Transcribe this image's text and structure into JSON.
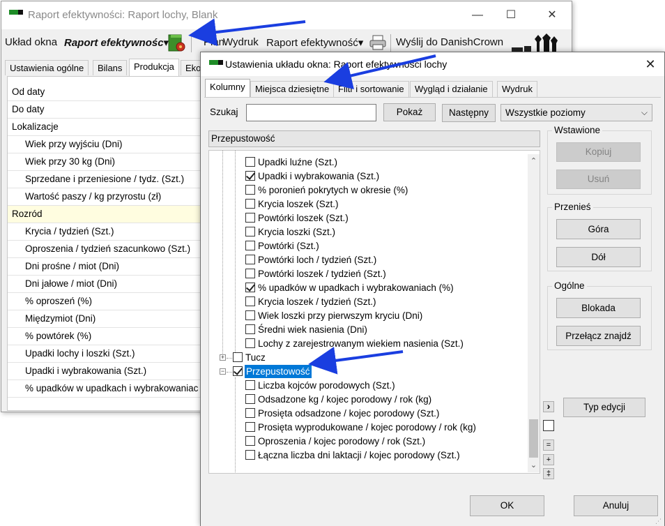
{
  "main_window": {
    "title": "Raport efektywności: Raport lochy, Blank",
    "controls": {
      "minimize": "—",
      "maximize": "☐",
      "close": "✕"
    },
    "toolbar": {
      "layout_label": "Układ okna",
      "layout_value": "Raport efektywnośc▾",
      "plan": "Plan",
      "print": "Wydruk",
      "report": "Raport efektywność▾",
      "send": "Wyślij do DanishCrown"
    },
    "tabs": [
      "Ustawienia ogólne",
      "Bilans",
      "Produkcja",
      "Eko"
    ],
    "rows": [
      {
        "label": "Od daty",
        "kind": "group"
      },
      {
        "label": "Do daty",
        "kind": "group"
      },
      {
        "label": "Lokalizacje",
        "kind": "group"
      },
      {
        "label": "Wiek przy wyjściu (Dni)",
        "kind": "item"
      },
      {
        "label": "Wiek przy 30 kg (Dni)",
        "kind": "item"
      },
      {
        "label": "Sprzedane i przeniesione / tydz. (Szt.)",
        "kind": "item"
      },
      {
        "label": "Wartość paszy / kg przyrostu (zł)",
        "kind": "item"
      },
      {
        "label": "Rozród",
        "kind": "group-hl"
      },
      {
        "label": "Krycia / tydzień (Szt.)",
        "kind": "item"
      },
      {
        "label": "Oproszenia / tydzień szacunkowo (Szt.)",
        "kind": "item"
      },
      {
        "label": "Dni prośne / miot (Dni)",
        "kind": "item"
      },
      {
        "label": "Dni jałowe / miot (Dni)",
        "kind": "item"
      },
      {
        "label": "% oproszeń (%)",
        "kind": "item"
      },
      {
        "label": "Międzymiot (Dni)",
        "kind": "item"
      },
      {
        "label": "% powtórek (%)",
        "kind": "item"
      },
      {
        "label": "Upadki lochy i loszki (Szt.)",
        "kind": "item"
      },
      {
        "label": "Upadki i wybrakowania (Szt.)",
        "kind": "item"
      },
      {
        "label": "% upadków w upadkach i wybrakowaniac",
        "kind": "item"
      }
    ]
  },
  "dialog": {
    "title": "Ustawienia układu okna: Raport efektywności lochy",
    "close": "✕",
    "tabs": [
      "Kolumny",
      "Miejsca dziesiętne",
      "Filtr i sortowanie",
      "Wygląd i działanie",
      "Wydruk"
    ],
    "search_label": "Szukaj",
    "search_value": "",
    "show_button": "Pokaż",
    "next_button": "Następny",
    "level_select": "Wszystkie poziomy",
    "header": "Przepustowość",
    "tree": [
      {
        "label": "Upadki luźne (Szt.)",
        "checked": false,
        "level": 1
      },
      {
        "label": "Upadki i wybrakowania (Szt.)",
        "checked": true,
        "level": 1
      },
      {
        "label": "% poronień pokrytych w okresie (%)",
        "checked": false,
        "level": 1
      },
      {
        "label": "Krycia loszek (Szt.)",
        "checked": false,
        "level": 1
      },
      {
        "label": "Powtórki loszek (Szt.)",
        "checked": false,
        "level": 1
      },
      {
        "label": "Krycia loszki (Szt.)",
        "checked": false,
        "level": 1
      },
      {
        "label": "Powtórki (Szt.)",
        "checked": false,
        "level": 1
      },
      {
        "label": "Powtórki loch / tydzień (Szt.)",
        "checked": false,
        "level": 1
      },
      {
        "label": "Powtórki loszek / tydzień (Szt.)",
        "checked": false,
        "level": 1
      },
      {
        "label": "% upadków w upadkach i wybrakowaniach (%)",
        "checked": true,
        "level": 1
      },
      {
        "label": "Krycia loszek / tydzień (Szt.)",
        "checked": false,
        "level": 1
      },
      {
        "label": "Wiek loszki przy pierwszym kryciu (Dni)",
        "checked": false,
        "level": 1
      },
      {
        "label": "Średni wiek nasienia (Dni)",
        "checked": false,
        "level": 1
      },
      {
        "label": "Lochy z zarejestrowanym wiekiem nasienia (Szt.)",
        "checked": false,
        "level": 1
      },
      {
        "label": "Tucz",
        "checked": false,
        "level": 0,
        "expander": "+"
      },
      {
        "label": "Przepustowość",
        "checked": true,
        "level": 0,
        "expander": "−",
        "selected": true
      },
      {
        "label": "Liczba kojców porodowych (Szt.)",
        "checked": false,
        "level": 1
      },
      {
        "label": "Odsadzone kg / kojec porodowy / rok (kg)",
        "checked": false,
        "level": 1
      },
      {
        "label": "Prosięta odsadzone / kojec porodowy (Szt.)",
        "checked": false,
        "level": 1
      },
      {
        "label": "Prosięta wyprodukowane / kojec porodowy / rok (kg)",
        "checked": false,
        "level": 1
      },
      {
        "label": "Oproszenia / kojec porodowy / rok (Szt.)",
        "checked": false,
        "level": 1
      },
      {
        "label": "Łączna liczba dni laktacji / kojec porodowy (Szt.)",
        "checked": false,
        "level": 1
      }
    ],
    "groups": {
      "inserted": {
        "label": "Wstawione",
        "copy": "Kopiuj",
        "delete": "Usuń"
      },
      "move": {
        "label": "Przenieś",
        "up": "Góra",
        "down": "Dół"
      },
      "general": {
        "label": "Ogólne",
        "lock": "Blokada",
        "toggle_find": "Przełącz znajdź"
      }
    },
    "edit_type_button": "Typ edycji",
    "side_buttons": {
      "arrow": "›",
      "minus": "=",
      "plus": "+",
      "plusminus": "‡"
    },
    "ok_button": "OK",
    "cancel_button": "Anuluj"
  },
  "colors": {
    "selection": "#0078d7",
    "annotation_arrow": "#1a3ee0",
    "highlight_row": "#fffde0"
  }
}
